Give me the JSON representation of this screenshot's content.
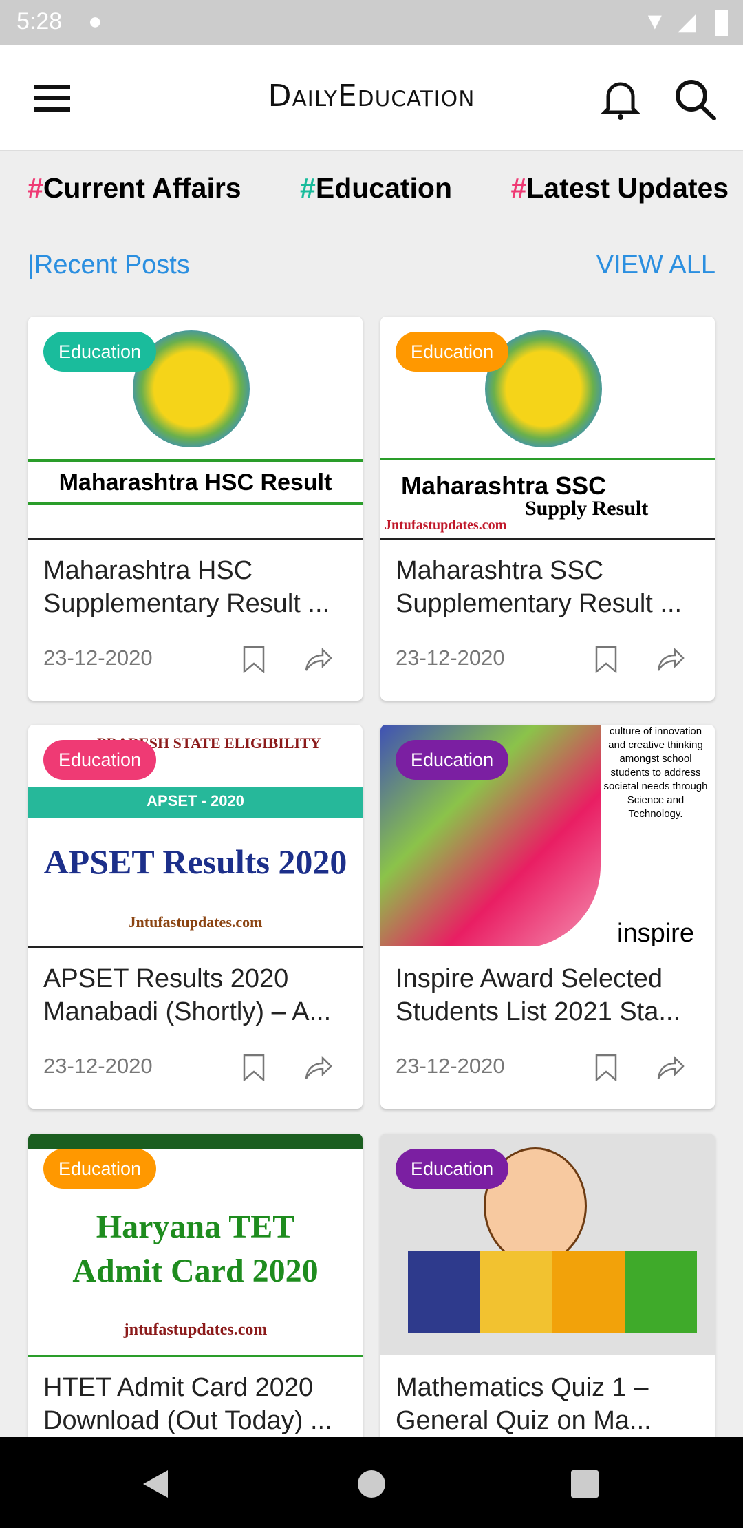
{
  "status_bar": {
    "time": "5:28"
  },
  "header": {
    "brand": "DailyEducation"
  },
  "tags": [
    {
      "hash": "#",
      "label": "Current Affairs",
      "color": "#ef3a74"
    },
    {
      "hash": "#",
      "label": "Education",
      "color": "#1abc9c"
    },
    {
      "hash": "#",
      "label": "Latest Updates",
      "color": "#ef3a74"
    }
  ],
  "section": {
    "title": "|Recent Posts",
    "view_all": "VIEW ALL"
  },
  "posts": [
    {
      "badge": "Education",
      "badge_color": "#1abc9c",
      "title": "Maharashtra HSC Supplementary Result ...",
      "date": "23-12-2020",
      "image_text": "Maharashtra HSC Result"
    },
    {
      "badge": "Education",
      "badge_color": "#ff9800",
      "title": "Maharashtra SSC Supplementary Result ...",
      "date": "23-12-2020",
      "image_text": "Maharashtra SSC",
      "image_sub": "Supply Result",
      "image_site": "Jntufastupdates.com"
    },
    {
      "badge": "Education",
      "badge_color": "#ef3a74",
      "title": "APSET Results 2020 Manabadi (Shortly) – A...",
      "date": "23-12-2020",
      "image_text": "APSET Results 2020",
      "image_sub": "APSET - 2020",
      "image_site": "Jntufastupdates.com",
      "image_head": "PRADESH STATE ELIGIBILITY"
    },
    {
      "badge": "Education",
      "badge_color": "#7b1fa2",
      "title": "Inspire Award Selected Students List 2021 Sta...",
      "date": "23-12-2020",
      "image_text": "culture of innovation and creative thinking amongst school students to address societal needs through Science and Technology.",
      "image_site": "inspire"
    },
    {
      "badge": "Education",
      "badge_color": "#ff9800",
      "title": "HTET Admit Card 2020 Download (Out Today) ...",
      "date": "",
      "image_text": "Haryana TET Admit Card 2020",
      "image_site": "jntufastupdates.com"
    },
    {
      "badge": "Education",
      "badge_color": "#7b1fa2",
      "title": "Mathematics Quiz 1 – General Quiz on Ma...",
      "date": ""
    }
  ]
}
